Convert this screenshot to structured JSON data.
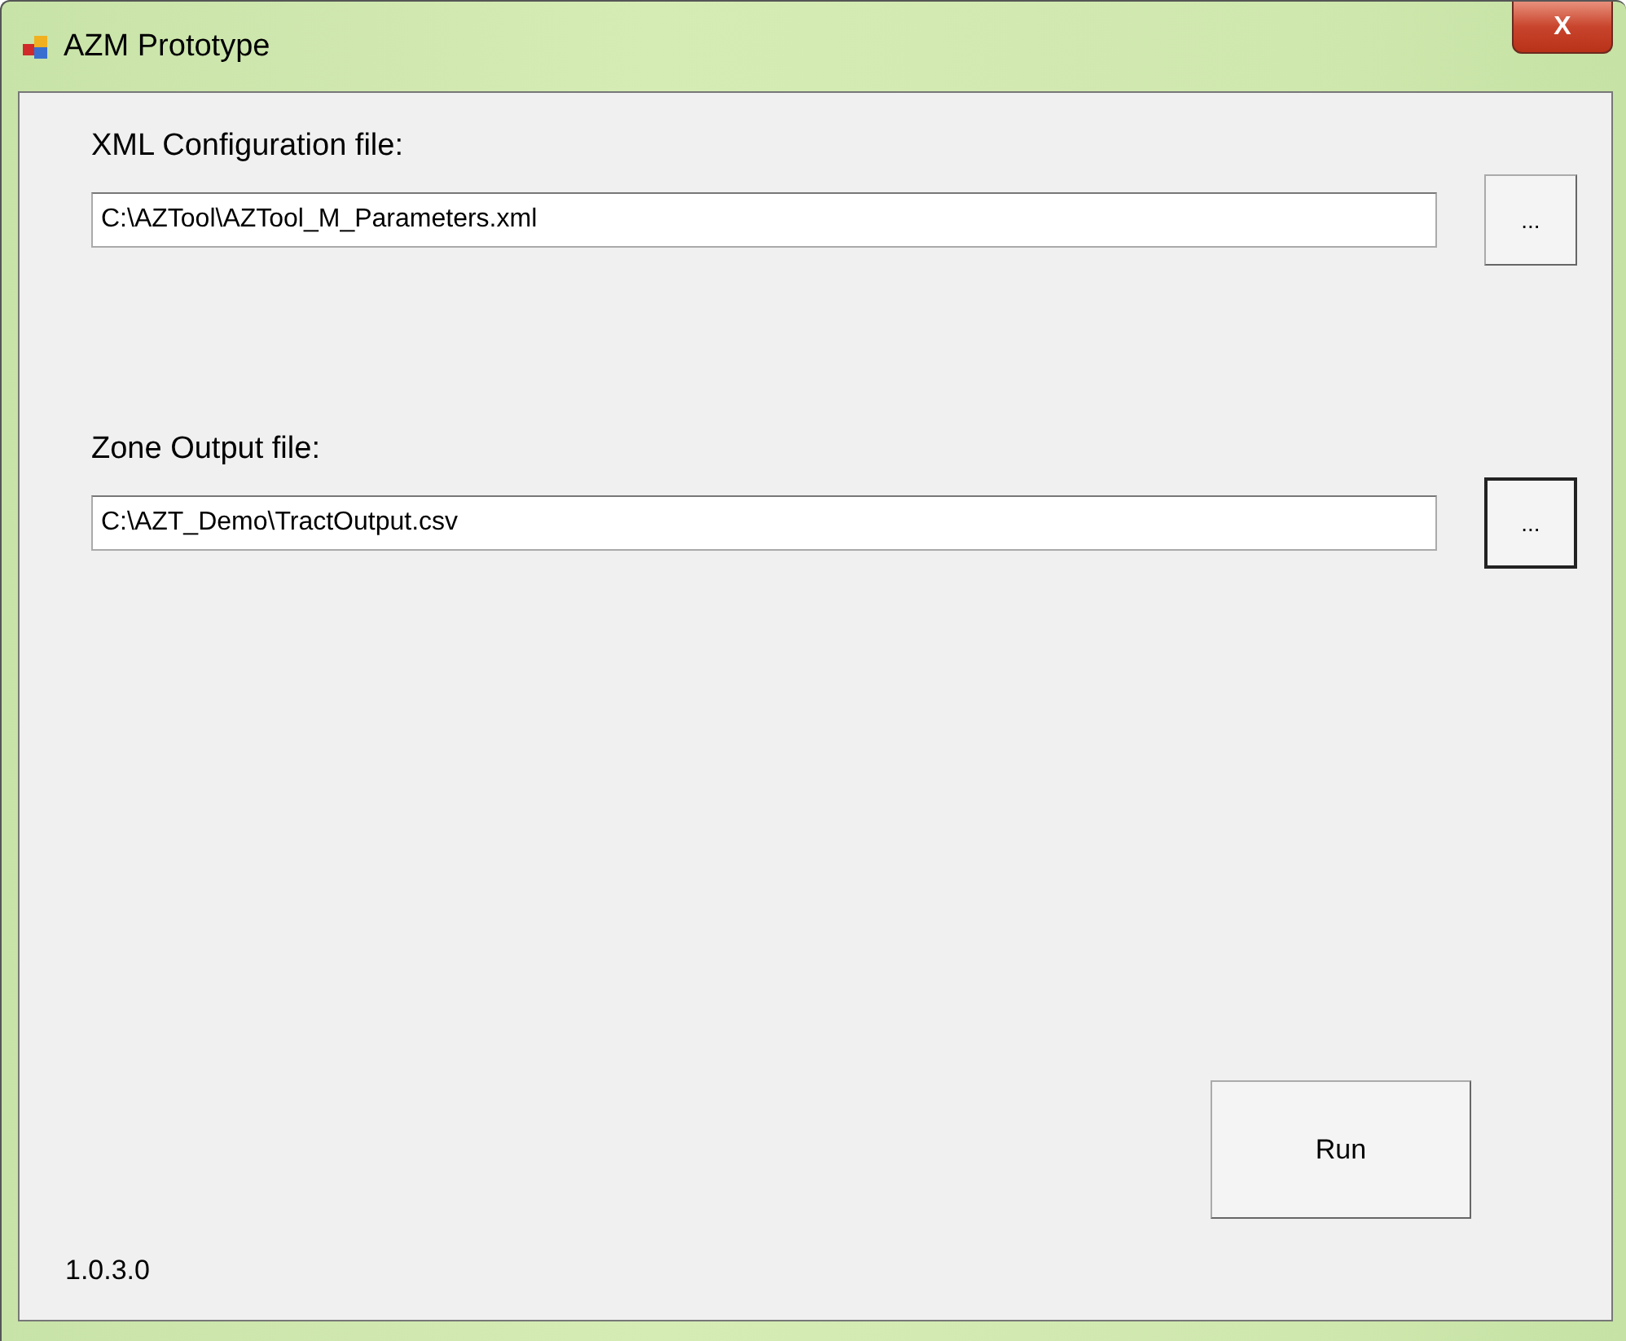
{
  "window": {
    "title": "AZM Prototype",
    "close_label": "X"
  },
  "file_fields": [
    {
      "label": "XML Configuration file:",
      "value": "C:\\AZTool\\AZTool_M_Parameters.xml",
      "browse_label": "...",
      "browse_focused": false
    },
    {
      "label": "Zone Output file:",
      "value": "C:\\AZT_Demo\\TractOutput.csv",
      "browse_label": "...",
      "browse_focused": true
    }
  ],
  "run_button": {
    "label": "Run"
  },
  "version": "1.0.3.0"
}
